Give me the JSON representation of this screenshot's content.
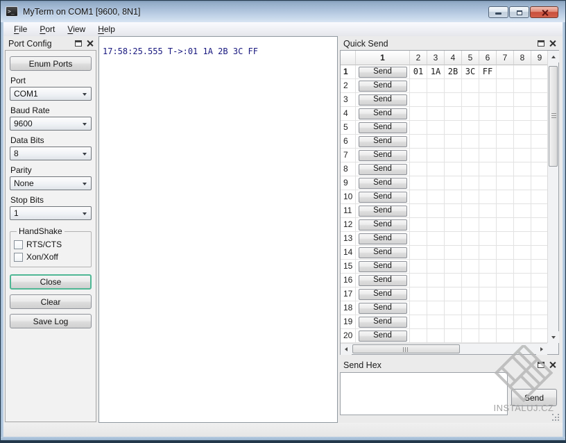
{
  "titlebar": {
    "title": "MyTerm on COM1 [9600, 8N1]",
    "icons": [
      "terminal-icon",
      "minimize-icon",
      "restore-icon",
      "close-icon"
    ]
  },
  "menu": {
    "items": [
      "File",
      "Port",
      "View",
      "Help"
    ]
  },
  "port_config": {
    "title": "Port Config",
    "enum_ports_label": "Enum Ports",
    "fields": [
      {
        "label": "Port",
        "value": "COM1"
      },
      {
        "label": "Baud Rate",
        "value": "9600"
      },
      {
        "label": "Data Bits",
        "value": "8"
      },
      {
        "label": "Parity",
        "value": "None"
      },
      {
        "label": "Stop Bits",
        "value": "1"
      }
    ],
    "handshake": {
      "title": "HandShake",
      "options": [
        {
          "label": "RTS/CTS",
          "checked": false
        },
        {
          "label": "Xon/Xoff",
          "checked": false
        }
      ]
    },
    "buttons": [
      "Close",
      "Clear",
      "Save Log"
    ]
  },
  "terminal": {
    "lines": [
      "17:58:25.555 T->:01 1A 2B 3C FF"
    ]
  },
  "quick_send": {
    "title": "Quick Send",
    "send_label": "Send",
    "columns": [
      "1",
      "2",
      "3",
      "4",
      "5",
      "6",
      "7",
      "8",
      "9"
    ],
    "rows": [
      {
        "num": "1",
        "values": [
          "01",
          "1A",
          "2B",
          "3C",
          "FF"
        ]
      },
      {
        "num": "2",
        "values": []
      },
      {
        "num": "3",
        "values": []
      },
      {
        "num": "4",
        "values": []
      },
      {
        "num": "5",
        "values": []
      },
      {
        "num": "6",
        "values": []
      },
      {
        "num": "7",
        "values": []
      },
      {
        "num": "8",
        "values": []
      },
      {
        "num": "9",
        "values": []
      },
      {
        "num": "10",
        "values": []
      },
      {
        "num": "11",
        "values": []
      },
      {
        "num": "12",
        "values": []
      },
      {
        "num": "13",
        "values": []
      },
      {
        "num": "14",
        "values": []
      },
      {
        "num": "15",
        "values": []
      },
      {
        "num": "16",
        "values": []
      },
      {
        "num": "17",
        "values": []
      },
      {
        "num": "18",
        "values": []
      },
      {
        "num": "19",
        "values": []
      },
      {
        "num": "20",
        "values": []
      }
    ]
  },
  "send_hex": {
    "title": "Send Hex",
    "send_label": "Send",
    "textarea_value": ""
  },
  "watermark": {
    "text": "INSTALUJ.CZ"
  },
  "colors": {
    "close_button_focus_ring": "#4fb794",
    "terminal_text": "#17177f",
    "titlebar_close_red": "#c8503c"
  }
}
